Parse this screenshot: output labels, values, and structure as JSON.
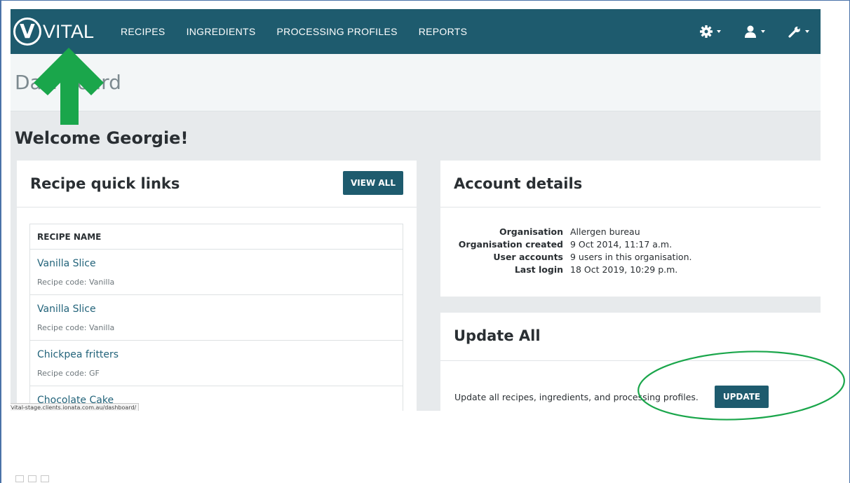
{
  "brand": {
    "name": "VITAL",
    "mark": "V"
  },
  "nav": {
    "links": [
      "RECIPES",
      "INGREDIENTS",
      "PROCESSING PROFILES",
      "REPORTS"
    ],
    "icons": [
      "gear-icon",
      "user-icon",
      "wrench-icon"
    ]
  },
  "header": {
    "title": "Dashboard"
  },
  "welcome": "Welcome Georgie!",
  "recipe_panel": {
    "title": "Recipe quick links",
    "view_all": "VIEW ALL",
    "column_header": "RECIPE NAME",
    "rows": [
      {
        "name": "Vanilla Slice",
        "code": "Recipe code: Vanilla"
      },
      {
        "name": "Vanilla Slice",
        "code": "Recipe code: Vanilla"
      },
      {
        "name": "Chickpea fritters",
        "code": "Recipe code: GF"
      },
      {
        "name": "Chocolate Cake",
        "code": ""
      }
    ]
  },
  "account_panel": {
    "title": "Account details",
    "rows": [
      {
        "label": "Organisation",
        "value": "Allergen bureau"
      },
      {
        "label": "Organisation created",
        "value": "9 Oct 2014, 11:17 a.m."
      },
      {
        "label": "User accounts",
        "value": "9 users in this organisation."
      },
      {
        "label": "Last login",
        "value": "18 Oct 2019, 10:29 p.m."
      }
    ]
  },
  "update_panel": {
    "title": "Update All",
    "text": "Update all recipes, ingredients, and processing profiles.",
    "button": "UPDATE"
  },
  "status_url": "/vital-stage.clients.ionata.com.au/dashboard/",
  "colors": {
    "navbar": "#1e5b6e",
    "link": "#22637a",
    "annotation": "#1aa64b"
  }
}
